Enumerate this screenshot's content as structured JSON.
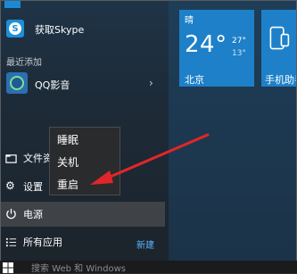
{
  "apps": {
    "skype_label": "获取Skype",
    "recent_header": "最近添加",
    "qq_label": "QQ影音",
    "file_label": "文件资",
    "settings_label": "设置",
    "power_label": "电源",
    "all_apps_label": "所有应用",
    "new_badge": "新建"
  },
  "power_menu": {
    "items": [
      "睡眠",
      "关机",
      "重启"
    ]
  },
  "tiles": {
    "weather": {
      "condition": "晴",
      "temp": "24°",
      "high": "27°",
      "low": "13°",
      "city": "北京"
    },
    "phone": {
      "label": "手机助手"
    }
  },
  "search": {
    "placeholder": "搜索 Web 和 Windows"
  },
  "colors": {
    "accent": "#1e80c8",
    "arrow": "#e0262a",
    "link": "#5cb6ff"
  }
}
